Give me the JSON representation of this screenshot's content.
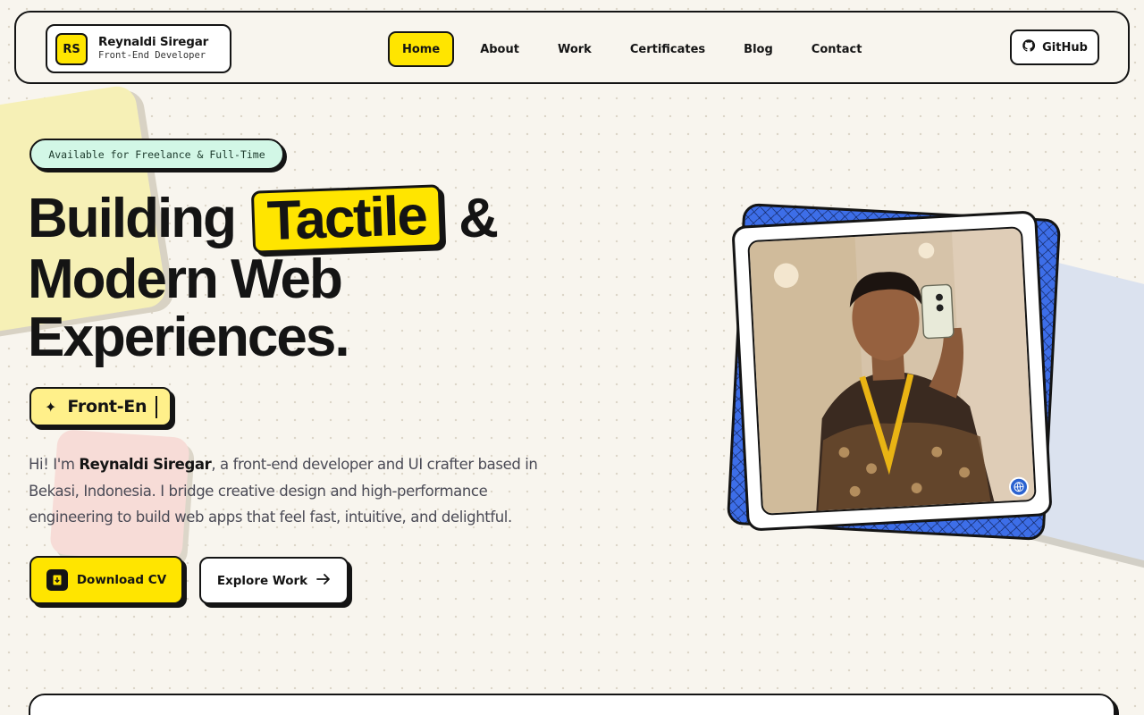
{
  "brand": {
    "logo_text": "RS",
    "name": "Reynaldi Siregar",
    "role": "Front-End Developer"
  },
  "nav": {
    "items": [
      {
        "label": "Home",
        "active": true
      },
      {
        "label": "About",
        "active": false
      },
      {
        "label": "Work",
        "active": false
      },
      {
        "label": "Certificates",
        "active": false
      },
      {
        "label": "Blog",
        "active": false
      },
      {
        "label": "Contact",
        "active": false
      }
    ],
    "github_label": "GitHub"
  },
  "hero": {
    "badge": "Available for Freelance & Full-Time",
    "headline": {
      "word1": "Building",
      "highlight": "Tactile",
      "amp": "&",
      "line2": "Modern Web",
      "line3": "Experiences."
    },
    "typing_text": "Front-En",
    "intro": {
      "greeting": "Hi! I'm ",
      "name": "Reynaldi Siregar",
      "rest": ", a front-end developer and UI crafter based in Bekasi, Indonesia. I bridge creative design and high-performance engineering to build web apps that feel fast, intuitive, and delightful."
    },
    "buttons": {
      "download_cv": "Download CV",
      "explore_work": "Explore Work"
    }
  },
  "colors": {
    "accent_yellow": "#ffe500",
    "ink": "#141414",
    "badge_green": "#d2f7e6",
    "photo_back_blue": "#3d6ee8"
  },
  "icons": [
    "github-icon",
    "sparkle-icon",
    "download-file-icon",
    "arrow-right-icon",
    "globe-icon"
  ]
}
